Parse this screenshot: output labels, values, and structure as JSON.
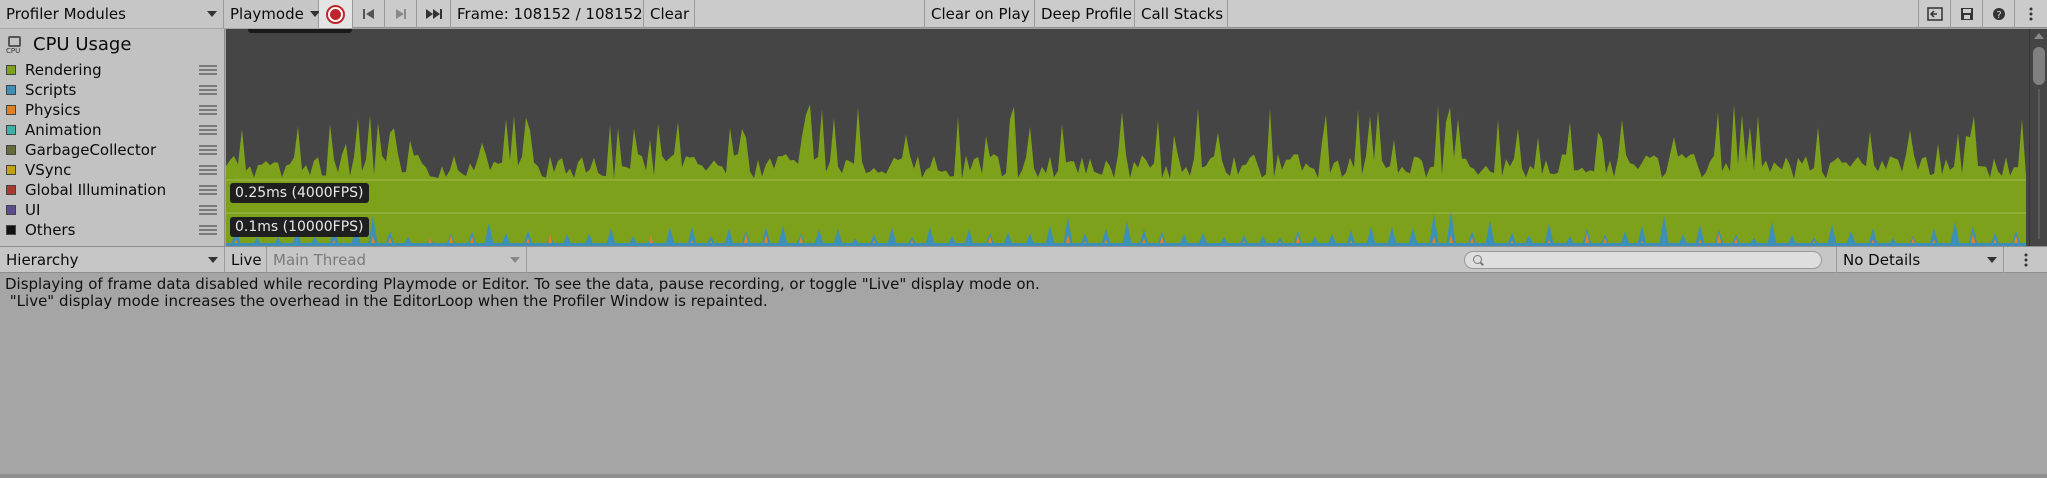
{
  "toolbar": {
    "modules_label": "Profiler Modules",
    "playmode_label": "Playmode",
    "frame_label": "Frame: 108152 / 108152",
    "clear_label": "Clear",
    "clear_on_play_label": "Clear on Play",
    "deep_profile_label": "Deep Profile",
    "call_stacks_label": "Call Stacks",
    "icons": [
      "record-icon",
      "first-frame-icon",
      "next-frame-icon",
      "last-frame-icon",
      "load-icon",
      "save-icon",
      "help-icon",
      "menu-icon"
    ]
  },
  "legend": {
    "title": "CPU Usage",
    "items": [
      {
        "label": "Rendering",
        "color": "#7da11a"
      },
      {
        "label": "Scripts",
        "color": "#3d8fb8"
      },
      {
        "label": "Physics",
        "color": "#e0801f"
      },
      {
        "label": "Animation",
        "color": "#3db0a8"
      },
      {
        "label": "GarbageCollector",
        "color": "#676b38"
      },
      {
        "label": "VSync",
        "color": "#c3a10e"
      },
      {
        "label": "Global Illumination",
        "color": "#a8392c"
      },
      {
        "label": "UI",
        "color": "#5c4a8e"
      },
      {
        "label": "Others",
        "color": "#111111"
      }
    ]
  },
  "chart": {
    "markers": [
      "0.25ms (4000FPS)",
      "0.1ms (10000FPS)"
    ],
    "background": "#454545"
  },
  "details": {
    "view_label": "Hierarchy",
    "live_label": "Live",
    "thread_label": "Main Thread",
    "search_placeholder": "",
    "details_label": "No Details"
  },
  "message": {
    "line1": "Displaying of frame data disabled while recording Playmode or Editor. To see the data, pause recording, or toggle \"Live\" display mode on.",
    "line2": " \"Live\" display mode increases the overhead in the EditorLoop when the Profiler Window is repainted."
  }
}
